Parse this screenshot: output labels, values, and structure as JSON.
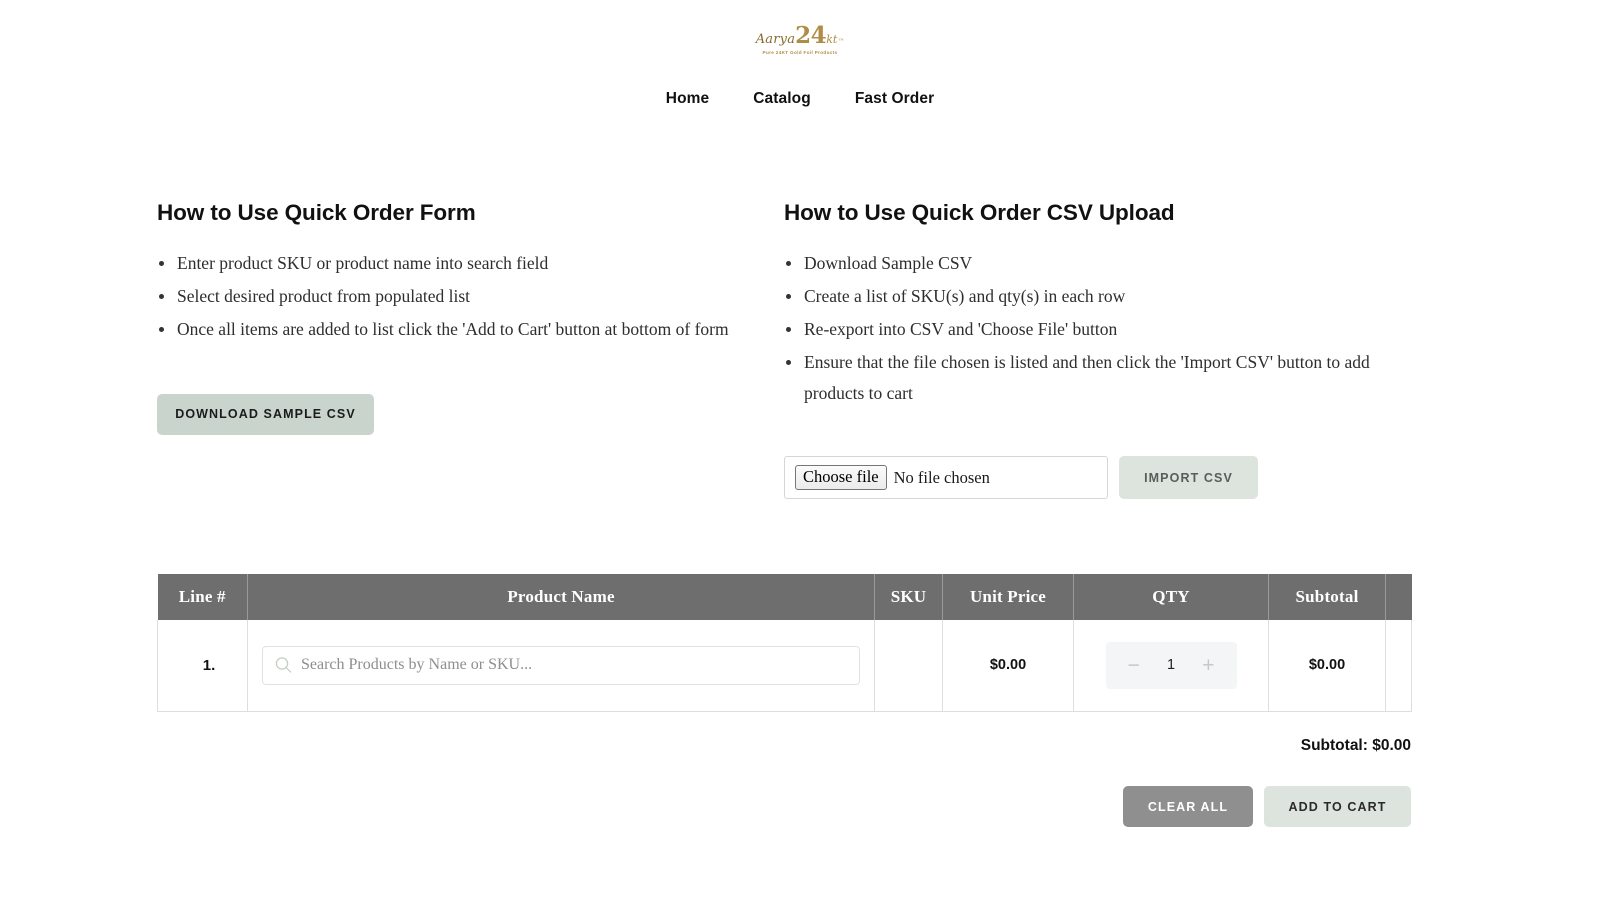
{
  "header": {
    "logo": {
      "script_text": "Aarya",
      "big_text": "24",
      "kt_text": "kt",
      "tm": "™",
      "tagline": "Pure 24KT Gold Foil Products",
      "color": "#b08d45"
    },
    "nav": [
      {
        "label": "Home",
        "name": "nav-link-home"
      },
      {
        "label": "Catalog",
        "name": "nav-link-catalog"
      },
      {
        "label": "Fast Order",
        "name": "nav-link-fast-order"
      }
    ]
  },
  "left_panel": {
    "heading": "How to Use Quick Order Form",
    "steps": [
      "Enter product SKU or product name into search field",
      "Select desired product from populated list",
      "Once all items are added to list click the 'Add to Cart' button at bottom of form"
    ],
    "download_button": "DOWNLOAD SAMPLE CSV"
  },
  "right_panel": {
    "heading": "How to Use Quick Order CSV Upload",
    "steps": [
      "Download Sample CSV",
      "Create a list of SKU(s) and qty(s) in each row",
      "Re-export into CSV and 'Choose File' button",
      "Ensure that the file chosen is listed and then click the 'Import CSV' button to add products to cart"
    ],
    "file_input": {
      "button_label": "Choose file",
      "status_text": "No file chosen"
    },
    "import_button": "IMPORT CSV"
  },
  "order_table": {
    "columns": [
      "Line #",
      "Product Name",
      "SKU",
      "Unit Price",
      "QTY",
      "Subtotal",
      ""
    ],
    "rows": [
      {
        "line_no": "1.",
        "search_placeholder": "Search Products by Name or SKU...",
        "sku": "",
        "unit_price": "$0.00",
        "qty": "1",
        "qty_decrement": "−",
        "qty_increment": "+",
        "subtotal": "$0.00"
      }
    ],
    "footer": {
      "subtotal_label": "Subtotal: $0.00",
      "clear_all": "CLEAR ALL",
      "add_to_cart": "ADD TO CART"
    }
  },
  "colors": {
    "sage": "#c9d4cc",
    "sage_light": "#dde3dd",
    "grey_button": "#8f8f8f",
    "table_header": "#6e6e6e",
    "gold": "#b08d45"
  }
}
